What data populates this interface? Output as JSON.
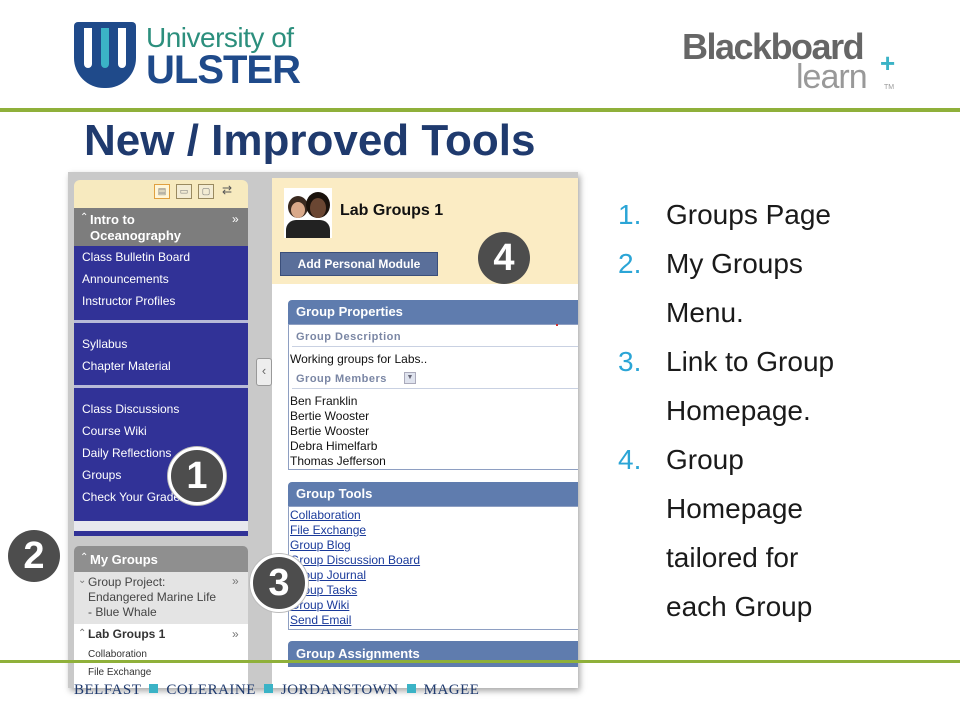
{
  "header": {
    "university_line1": "University of",
    "university_line2": "ULSTER",
    "blackboard_line1": "Blackboard",
    "blackboard_line2": "learn",
    "blackboard_plus": "+",
    "blackboard_tm": "TM"
  },
  "slide_title": "New / Improved Tools",
  "course_menu": {
    "title": "Intro to Oceanography",
    "section1": [
      "Class Bulletin Board",
      "Announcements",
      "Instructor Profiles"
    ],
    "section2": [
      "Syllabus",
      "Chapter Material"
    ],
    "section3": [
      "Class Discussions",
      "Course Wiki",
      "Daily Reflections",
      "Groups",
      "Check Your Grades"
    ]
  },
  "my_groups": {
    "title": "My Groups",
    "group1": "Group Project: Endangered Marine Life - Blue Whale",
    "group2": "Lab Groups 1",
    "group2_links": [
      "Collaboration",
      "File Exchange"
    ]
  },
  "group_page": {
    "title": "Lab Groups 1",
    "add_module_button": "Add Personal Module",
    "properties": {
      "title": "Group Properties",
      "description_label": "Group Description",
      "description": "Working groups for Labs..",
      "members_label": "Group Members",
      "members": [
        "Ben Franklin",
        "Bertie Wooster",
        "Bertie Wooster",
        "Debra Himelfarb",
        "Thomas Jefferson"
      ]
    },
    "tools": {
      "title": "Group Tools",
      "links": [
        "Collaboration",
        "File Exchange",
        "Group Blog",
        "Group Discussion Board",
        "Group Journal",
        "Group Tasks",
        "Group Wiki",
        "Send Email"
      ]
    },
    "assignments_title": "Group Assignments"
  },
  "badges": [
    "1",
    "2",
    "3",
    "4"
  ],
  "list": {
    "numbers": [
      "1.",
      "2.",
      "3.",
      "4."
    ],
    "items": [
      "Groups Page",
      "My Groups Menu.",
      "Link to Group Homepage.",
      "Group Homepage tailored for each Group"
    ]
  },
  "footer": {
    "campuses": [
      "BELFAST",
      "COLERAINE",
      "JORDANSTOWN",
      "MAGEE"
    ]
  },
  "colors": {
    "title_navy": "#1f3a6e",
    "menu_blue": "#313297",
    "module_header": "#5f7cae",
    "accent_green": "#8fb03a",
    "list_number": "#2ba5d6",
    "badge_grey": "#4d4d4d"
  }
}
